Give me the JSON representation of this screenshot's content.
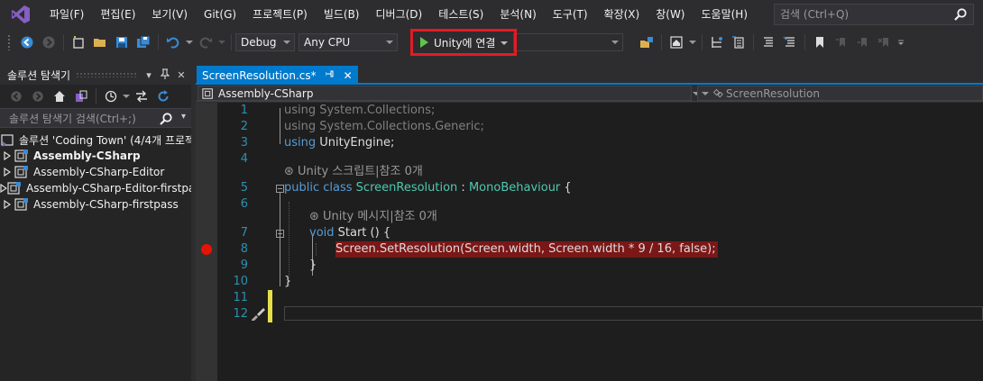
{
  "menu": {
    "items": [
      "파일(F)",
      "편집(E)",
      "보기(V)",
      "Git(G)",
      "프로젝트(P)",
      "빌드(B)",
      "디버그(D)",
      "테스트(S)",
      "분석(N)",
      "도구(T)",
      "확장(X)",
      "창(W)",
      "도움말(H)"
    ],
    "search_placeholder": "검색 (Ctrl+Q)"
  },
  "toolbar": {
    "config": "Debug",
    "platform": "Any CPU",
    "run_label": "Unity에 연결"
  },
  "solution_explorer": {
    "title": "솔루션 탐색기",
    "search_placeholder": "솔루션 탐색기 검색(Ctrl+;)",
    "items": [
      {
        "label": "솔루션 'Coding Town' (4/4개 프로젝트)",
        "bold": false,
        "expander": false
      },
      {
        "label": "Assembly-CSharp",
        "bold": true,
        "expander": true
      },
      {
        "label": "Assembly-CSharp-Editor",
        "bold": false,
        "expander": true
      },
      {
        "label": "Assembly-CSharp-Editor-firstpass",
        "bold": false,
        "expander": true
      },
      {
        "label": "Assembly-CSharp-firstpass",
        "bold": false,
        "expander": true
      }
    ]
  },
  "editor": {
    "tab_label": "ScreenResolution.cs*",
    "nav_left": "Assembly-CSharp",
    "nav_right": "ScreenResolution",
    "line_numbers": [
      "1",
      "2",
      "3",
      "4",
      "5",
      "6",
      "7",
      "8",
      "9",
      "10",
      "11",
      "12"
    ],
    "lines": {
      "l1_kw": "using",
      "l1_rest": " System.Collections;",
      "l2_kw": "using",
      "l2_rest": " System.Collections.Generic;",
      "l3_kw": "using",
      "l3_rest": " UnityEngine;",
      "lens1": "Unity 스크립트|참조 0개",
      "l5_kw": "public class",
      "l5_type": "ScreenResolution",
      "l5_colon": " : ",
      "l5_base": "MonoBehaviour",
      "l5_brace": " {",
      "lens2": "Unity 메시지|참조 0개",
      "l7_kw": "void",
      "l7_rest": " Start () {",
      "l8_code": "Screen.SetResolution(Screen.width, Screen.width * 9 / 16, false);",
      "l9_code": "}",
      "l10_code": "}"
    }
  },
  "colors": {
    "accent": "#007acc",
    "breakpoint": "#e51400",
    "highlight_box": "#e31b23"
  }
}
